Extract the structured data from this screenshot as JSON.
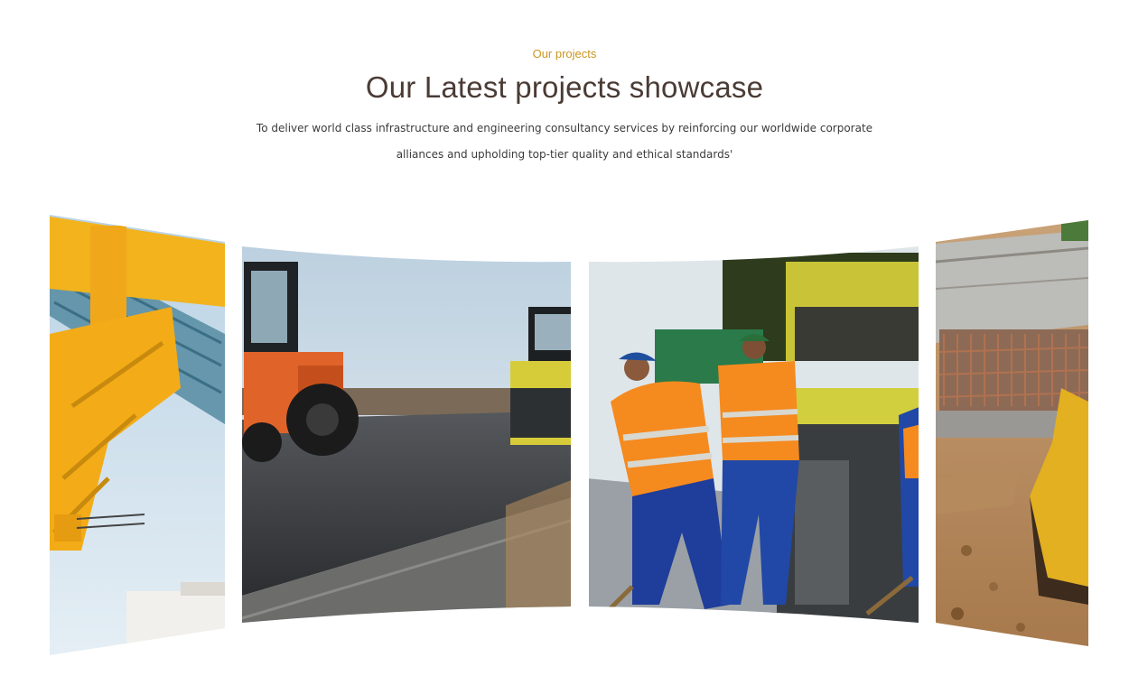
{
  "section": {
    "eyebrow": "Our projects",
    "title": "Our Latest projects showcase",
    "description": "To deliver world class infrastructure and engineering consultancy services by reinforcing our worldwide corporate alliances and upholding top-tier quality and ethical standards'"
  },
  "colors": {
    "accent": "#c9961f",
    "heading": "#4a3b35",
    "body_text": "#3b3b3b"
  },
  "slides": [
    {
      "name": "project-slide-crane",
      "icon": "crane-photo"
    },
    {
      "name": "project-slide-road-roller",
      "icon": "road-roller-photo"
    },
    {
      "name": "project-slide-paving-workers",
      "icon": "paving-workers-photo"
    },
    {
      "name": "project-slide-excavation",
      "icon": "excavator-photo"
    }
  ]
}
